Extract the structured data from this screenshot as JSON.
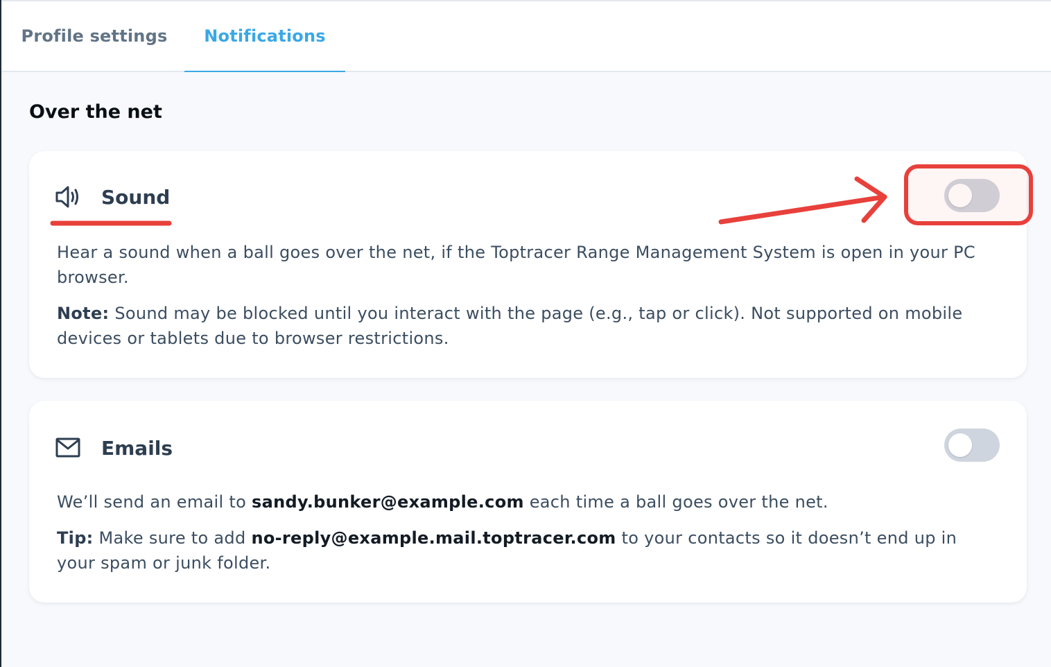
{
  "tabs": {
    "profile_label": "Profile settings",
    "notifications_label": "Notifications",
    "active": "Notifications"
  },
  "section": {
    "title": "Over the net"
  },
  "sound": {
    "icon": "speaker-icon",
    "title": "Sound",
    "description": "Hear a sound when a ball goes over the net, if the Toptracer Range Management System is open in your PC browser.",
    "note_label": "Note:",
    "note_text": " Sound may be blocked until you interact with the page (e.g., tap or click). Not supported on mobile devices or tablets due to browser restrictions.",
    "toggle_on": false
  },
  "emails": {
    "icon": "mail-icon",
    "title": "Emails",
    "description_prefix": "We’ll send an email to ",
    "email": "sandy.bunker@example.com",
    "description_suffix": " each time a ball goes over the net.",
    "tip_label": "Tip:",
    "tip_prefix": " Make sure to add  ",
    "tip_email": "no-reply@example.mail.toptracer.com",
    "tip_suffix": "  to your contacts so it doesn’t end up in your spam or junk folder.",
    "toggle_on": false
  },
  "colors": {
    "accent": "#3aa8e6",
    "annotation": "#e8403b",
    "toggle_off": "#cfd5de",
    "heading": "#0a0f14",
    "text": "#3b4d60"
  }
}
